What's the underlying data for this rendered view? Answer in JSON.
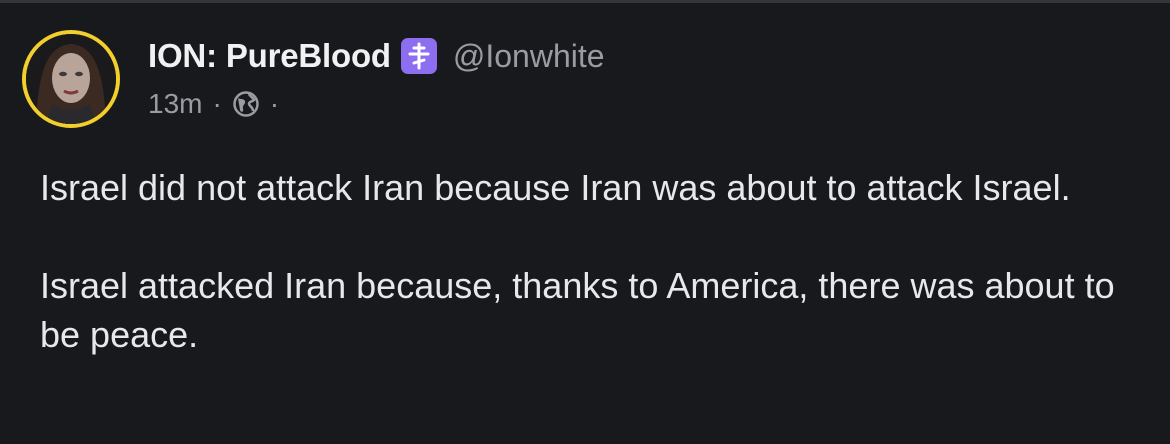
{
  "post": {
    "author": {
      "display_name": "ION: PureBlood",
      "badge_icon": "orthodox-cross-icon",
      "badge_color": "#8e6ef0",
      "handle": "@Ionwhite",
      "avatar_ring_color": "#f2cf2b"
    },
    "meta": {
      "timestamp": "13m",
      "separator": "·",
      "visibility_icon": "globe-icon"
    },
    "paragraphs": [
      "Israel did not attack Iran because Iran was about to attack Israel.",
      "Israel attacked Iran because, thanks to America, there was about to be peace."
    ]
  }
}
